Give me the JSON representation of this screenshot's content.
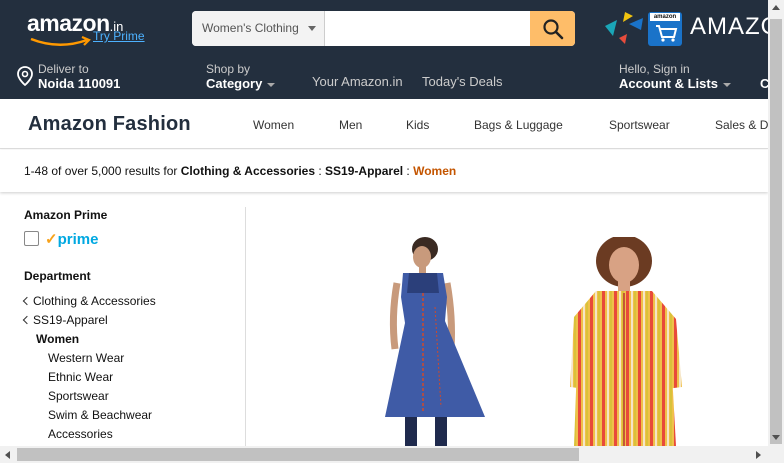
{
  "header": {
    "logo_text": "amazon",
    "logo_suffix": ".in",
    "try_prime": "Try Prime",
    "search": {
      "category": "Women's Clothing",
      "value": "",
      "placeholder": ""
    },
    "app_promo_text": "AMAZO",
    "app_box_label": "amazon",
    "deliver_label": "Deliver to",
    "deliver_location": "Noida 110091",
    "shop_by_label": "Shop by",
    "shop_by_value": "Category",
    "nav_links": [
      "Your Amazon.in",
      "Today's Deals"
    ],
    "signin_label": "Hello, Sign in",
    "account_label": "Account & Lists",
    "truncated_next": "C"
  },
  "fashion_nav": {
    "title": "Amazon Fashion",
    "links": [
      "Women",
      "Men",
      "Kids",
      "Bags & Luggage",
      "Sportswear",
      "Sales & D"
    ]
  },
  "results": {
    "count": "1-48 of over 5,000 results for",
    "crumb1": "Clothing & Accessories",
    "sep": " : ",
    "crumb2": "SS19-Apparel",
    "current": "Women"
  },
  "sidebar": {
    "prime_heading": "Amazon Prime",
    "prime_logo": "prime",
    "department_heading": "Department",
    "back_items": [
      "Clothing & Accessories",
      "SS19-Apparel"
    ],
    "current_dept": "Women",
    "sub_items": [
      "Western Wear",
      "Ethnic Wear",
      "Sportswear",
      "Swim & Beachwear",
      "Accessories"
    ]
  },
  "colors": {
    "nav_dark": "#232f3e",
    "search_button": "#febd69",
    "prime_blue": "#00a8e1",
    "link_orange": "#c45500"
  }
}
